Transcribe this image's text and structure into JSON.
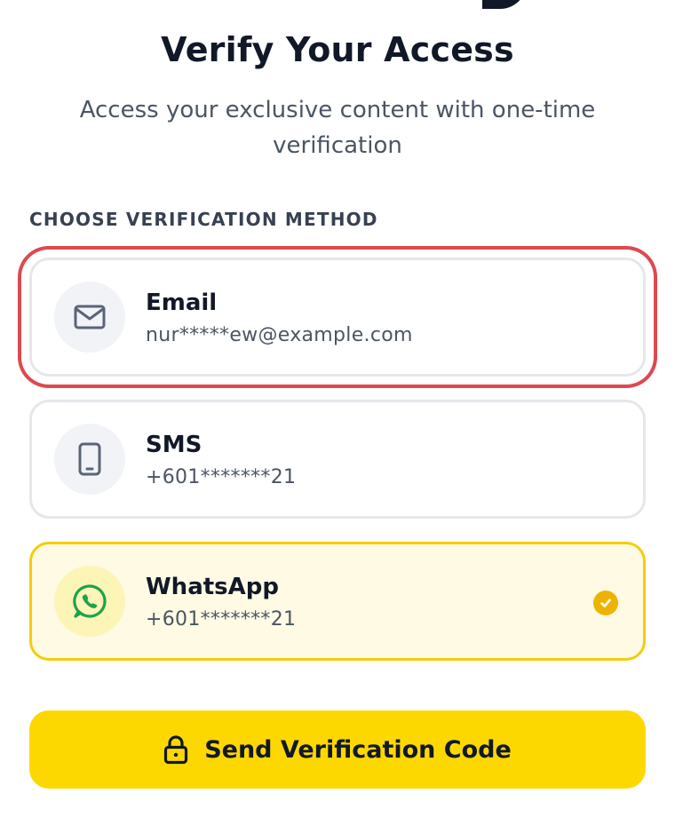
{
  "header": {
    "title": "Verify Your Access",
    "subtitle": "Access your exclusive content with one-time verification"
  },
  "section_label": "CHOOSE VERIFICATION METHOD",
  "methods": [
    {
      "name": "Email",
      "contact": "nur*****ew@example.com",
      "icon": "envelope-icon",
      "selected": false,
      "highlighted": true
    },
    {
      "name": "SMS",
      "contact": "+601*******21",
      "icon": "smartphone-icon",
      "selected": false,
      "highlighted": false
    },
    {
      "name": "WhatsApp",
      "contact": "+601*******21",
      "icon": "whatsapp-icon",
      "selected": true,
      "highlighted": false
    }
  ],
  "send_button": {
    "label": "Send Verification Code",
    "icon": "lock-icon"
  },
  "colors": {
    "accent": "#fdd800",
    "selected_border": "#f3cd0f",
    "selected_bg": "#fefae4",
    "check": "#eeb300",
    "highlight_outline": "#dc4a4f",
    "whatsapp_green": "#1aa44a"
  }
}
